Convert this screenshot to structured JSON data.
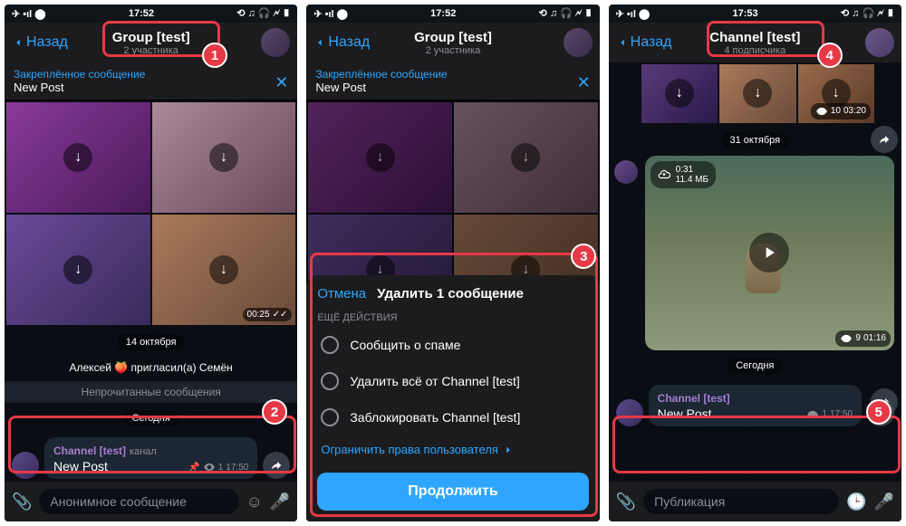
{
  "status": {
    "time": "17:52",
    "time2": "17:52",
    "time3": "17:53"
  },
  "back": "Назад",
  "p1": {
    "title": "Group [test]",
    "subtitle": "2 участника",
    "pinned_label": "Закреплённое сообщение",
    "pinned_text": "New Post",
    "media_time": "00:25",
    "date": "14 октября",
    "sys": "Алексей 🍑 пригласил(а) Семён",
    "unread": "Непрочитанные сообщения",
    "today": "Сегодня",
    "msg_sender": "Channel [test]",
    "msg_chan": "канал",
    "msg_text": "New Post",
    "msg_time": "17:50",
    "msg_views": "1",
    "input": "Анонимное сообщение"
  },
  "p2": {
    "title": "Group [test]",
    "subtitle": "2 участника",
    "pinned_label": "Закреплённое сообщение",
    "pinned_text": "New Post",
    "cancel": "Отмена",
    "sheet_title": "Удалить 1 сообщение",
    "section": "ЕЩЁ ДЕЙСТВИЯ",
    "opt1": "Сообщить о спаме",
    "opt2": "Удалить всё от Channel [test]",
    "opt3": "Заблокировать Channel [test]",
    "restrict": "Ограничить права пользователя",
    "continue": "Продолжить"
  },
  "p3": {
    "title": "Channel [test]",
    "subtitle": "4 подписчика",
    "media_views": "10",
    "media_time": "03:20",
    "date": "31 октября",
    "video_dur": "0:31",
    "video_size": "11.4 МБ",
    "video_views": "9",
    "video_time": "01:16",
    "today": "Сегодня",
    "msg_sender": "Channel [test]",
    "msg_text": "New Post",
    "msg_views": "1",
    "msg_time": "17:50",
    "input": "Публикация"
  },
  "badges": {
    "b1": "1",
    "b2": "2",
    "b3": "3",
    "b4": "4",
    "b5": "5"
  }
}
